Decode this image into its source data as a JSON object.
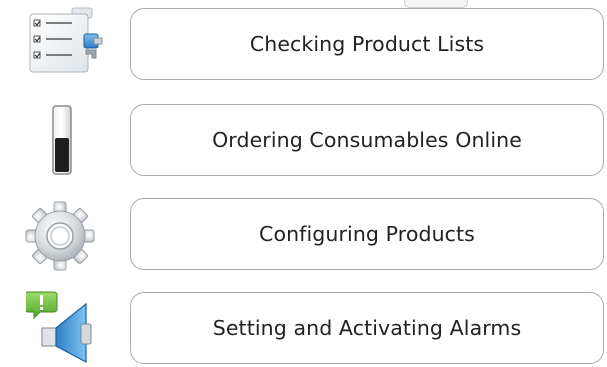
{
  "menu": {
    "items": [
      {
        "label": "Checking Product Lists",
        "icon": "checklist-icon"
      },
      {
        "label": "Ordering Consumables Online",
        "icon": "toner-level-icon"
      },
      {
        "label": "Configuring Products",
        "icon": "gear-icon"
      },
      {
        "label": "Setting and Activating Alarms",
        "icon": "alarm-speaker-icon"
      }
    ]
  },
  "colors": {
    "border": "#a9a9a9",
    "text": "#222222",
    "icon_blue": "#3a8fd8",
    "icon_green": "#5cb83a"
  }
}
